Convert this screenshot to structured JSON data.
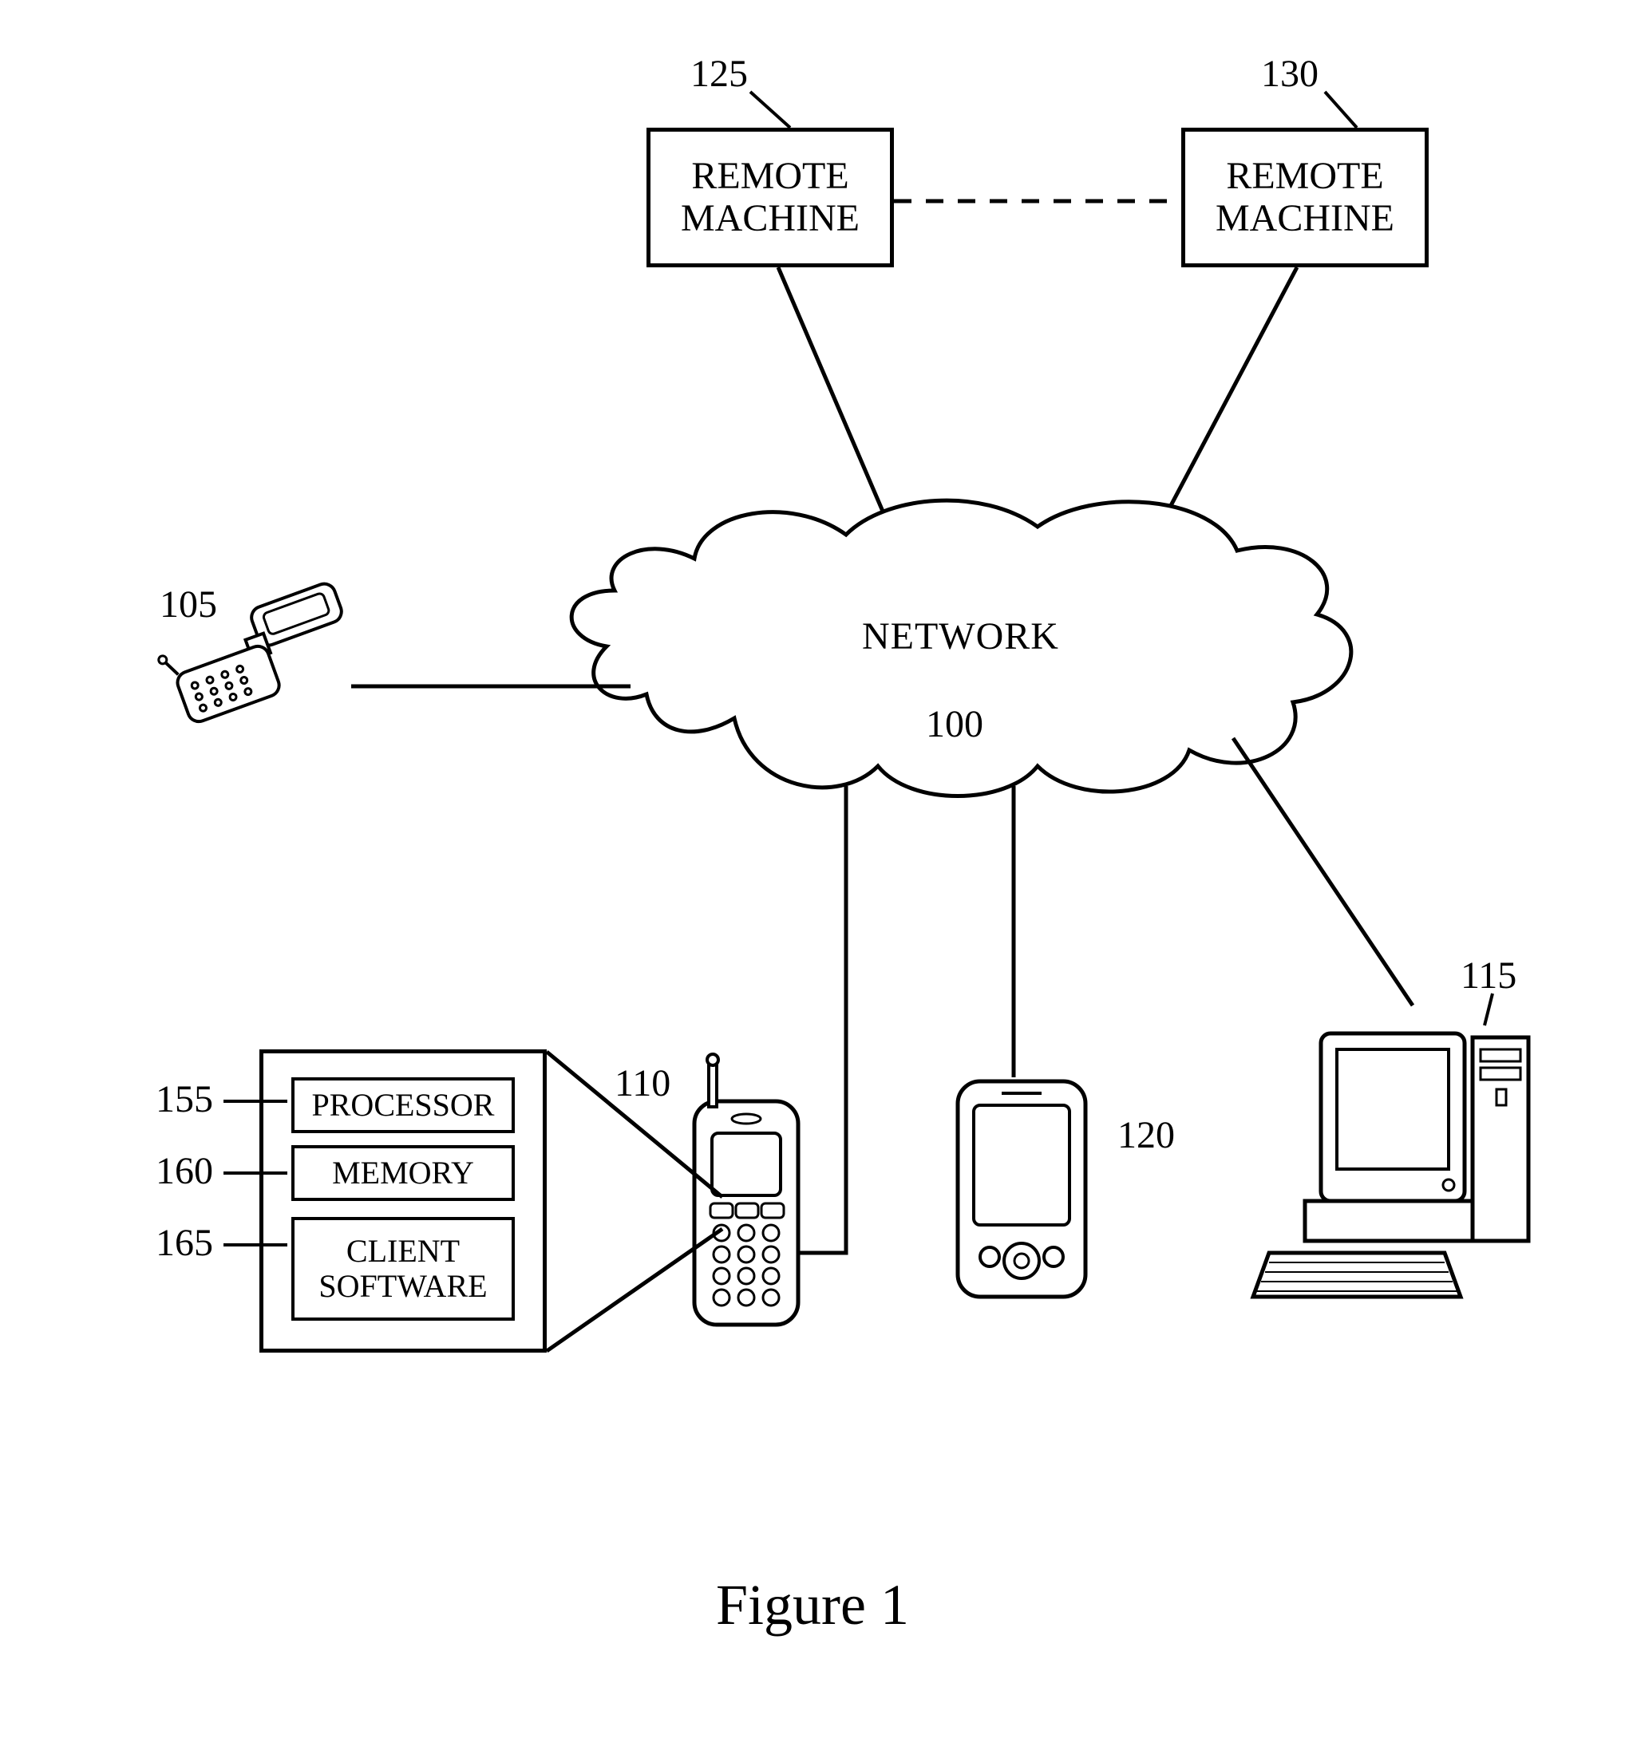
{
  "figure_caption": "Figure 1",
  "network": {
    "label": "NETWORK",
    "ref": "100"
  },
  "remote_machine_left": {
    "label": "REMOTE\nMACHINE",
    "ref": "125"
  },
  "remote_machine_right": {
    "label": "REMOTE\nMACHINE",
    "ref": "130"
  },
  "flip_phone": {
    "ref": "105"
  },
  "cell_phone": {
    "ref": "110"
  },
  "pda": {
    "ref": "120"
  },
  "desktop": {
    "ref": "115"
  },
  "client_box": {
    "processor": {
      "label": "PROCESSOR",
      "ref": "155"
    },
    "memory": {
      "label": "MEMORY",
      "ref": "160"
    },
    "software": {
      "label": "CLIENT\nSOFTWARE",
      "ref": "165"
    }
  }
}
